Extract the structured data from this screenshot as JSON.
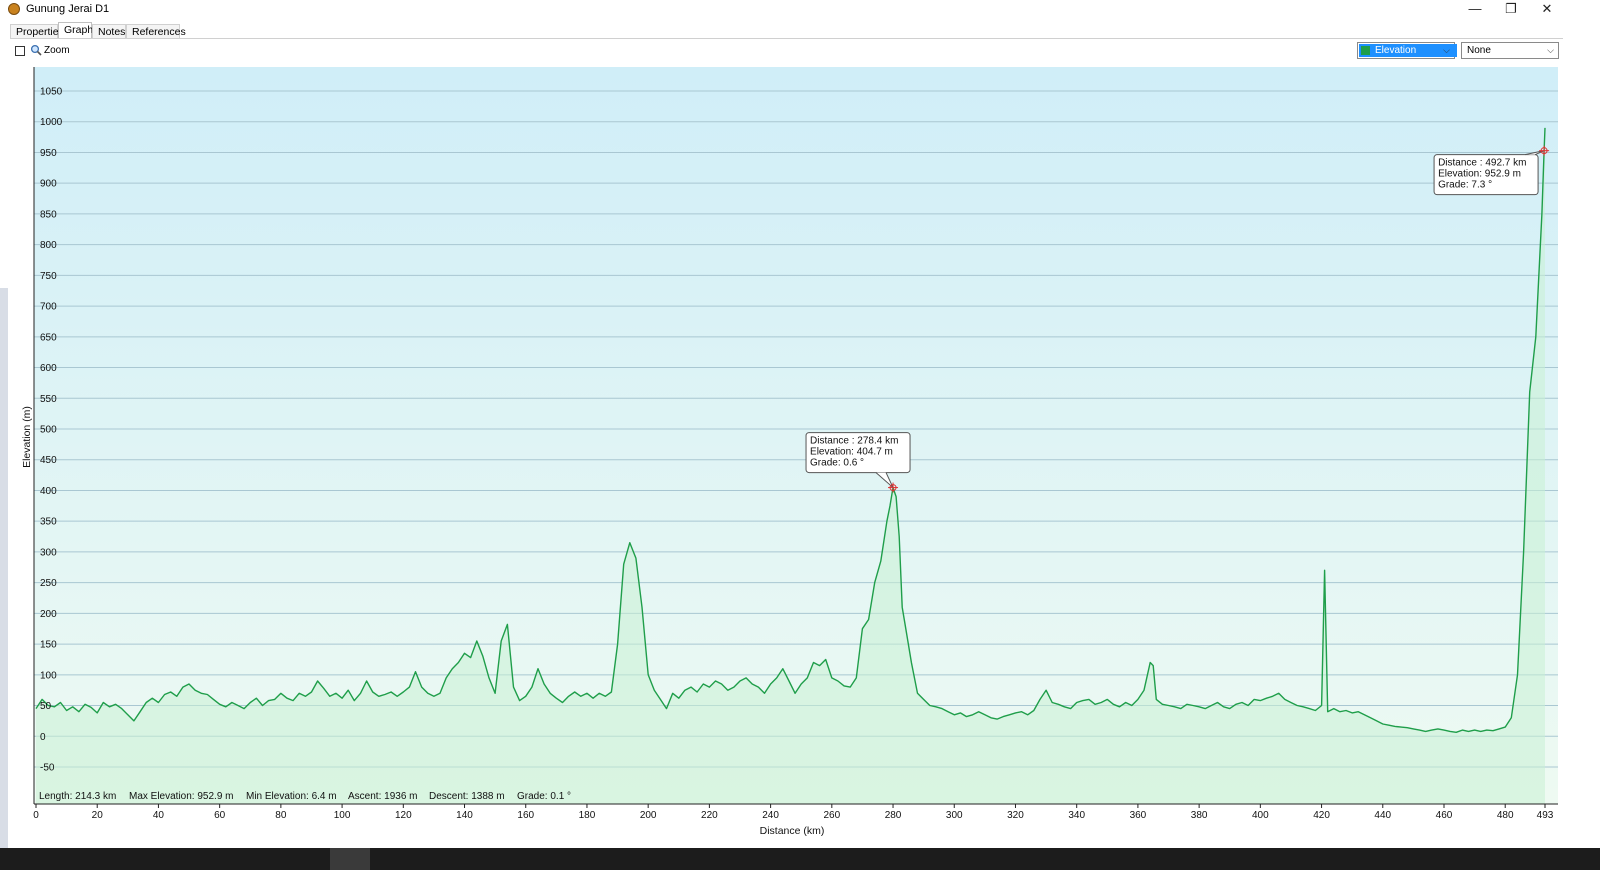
{
  "window": {
    "title": "Gunung Jerai D1",
    "minimize": "—",
    "restore": "❐",
    "close": "✕"
  },
  "tabs": [
    {
      "label": "Properties",
      "active": false
    },
    {
      "label": "Graph",
      "active": true
    },
    {
      "label": "Notes",
      "active": false
    },
    {
      "label": "References",
      "active": false
    }
  ],
  "toolbar": {
    "zoom_label": "Zoom",
    "zoom_checked": false,
    "series_select": "Elevation",
    "secondary_select": "None"
  },
  "colors": {
    "line": "#1f9e4a",
    "fill_top": "#d0eef8",
    "fill_bottom": "#eefaf2",
    "select_highlight": "#1e90ff"
  },
  "chart_data": {
    "type": "area",
    "xlabel": "Distance  (km)",
    "ylabel": "Elevation (m)",
    "xlim": [
      0,
      493
    ],
    "ylim": [
      -60,
      1090
    ],
    "x_ticks": [
      "0",
      "20",
      "40",
      "60",
      "80",
      "100",
      "120",
      "140",
      "160",
      "180",
      "200",
      "220",
      "240",
      "260",
      "280",
      "300",
      "320",
      "340",
      "360",
      "380",
      "400",
      "420",
      "440",
      "460",
      "480",
      "493"
    ],
    "y_ticks": [
      "1050",
      "1000",
      "950",
      "900",
      "850",
      "800",
      "750",
      "700",
      "650",
      "600",
      "550",
      "500",
      "450",
      "400",
      "350",
      "300",
      "250",
      "200",
      "150",
      "100",
      "50",
      "0",
      "-50"
    ],
    "grid": true,
    "series": [
      {
        "name": "Elevation",
        "points": [
          [
            0,
            45
          ],
          [
            2,
            60
          ],
          [
            4,
            50
          ],
          [
            6,
            48
          ],
          [
            8,
            55
          ],
          [
            10,
            42
          ],
          [
            12,
            48
          ],
          [
            14,
            40
          ],
          [
            16,
            52
          ],
          [
            18,
            47
          ],
          [
            20,
            38
          ],
          [
            22,
            55
          ],
          [
            24,
            48
          ],
          [
            26,
            52
          ],
          [
            28,
            45
          ],
          [
            30,
            35
          ],
          [
            32,
            25
          ],
          [
            34,
            40
          ],
          [
            36,
            55
          ],
          [
            38,
            62
          ],
          [
            40,
            55
          ],
          [
            42,
            68
          ],
          [
            44,
            72
          ],
          [
            46,
            65
          ],
          [
            48,
            80
          ],
          [
            50,
            85
          ],
          [
            52,
            75
          ],
          [
            54,
            70
          ],
          [
            56,
            68
          ],
          [
            58,
            60
          ],
          [
            60,
            52
          ],
          [
            62,
            48
          ],
          [
            64,
            55
          ],
          [
            66,
            50
          ],
          [
            68,
            45
          ],
          [
            70,
            55
          ],
          [
            72,
            62
          ],
          [
            74,
            50
          ],
          [
            76,
            58
          ],
          [
            78,
            60
          ],
          [
            80,
            70
          ],
          [
            82,
            62
          ],
          [
            84,
            58
          ],
          [
            86,
            70
          ],
          [
            88,
            65
          ],
          [
            90,
            72
          ],
          [
            92,
            90
          ],
          [
            94,
            78
          ],
          [
            96,
            65
          ],
          [
            98,
            70
          ],
          [
            100,
            62
          ],
          [
            102,
            75
          ],
          [
            104,
            58
          ],
          [
            106,
            70
          ],
          [
            108,
            90
          ],
          [
            110,
            72
          ],
          [
            112,
            65
          ],
          [
            114,
            68
          ],
          [
            116,
            72
          ],
          [
            118,
            65
          ],
          [
            120,
            72
          ],
          [
            122,
            80
          ],
          [
            124,
            105
          ],
          [
            126,
            80
          ],
          [
            128,
            70
          ],
          [
            130,
            65
          ],
          [
            132,
            70
          ],
          [
            134,
            95
          ],
          [
            136,
            110
          ],
          [
            138,
            120
          ],
          [
            140,
            135
          ],
          [
            142,
            128
          ],
          [
            144,
            155
          ],
          [
            146,
            130
          ],
          [
            148,
            95
          ],
          [
            150,
            70
          ],
          [
            152,
            155
          ],
          [
            154,
            182
          ],
          [
            156,
            80
          ],
          [
            158,
            58
          ],
          [
            160,
            65
          ],
          [
            162,
            80
          ],
          [
            164,
            110
          ],
          [
            166,
            85
          ],
          [
            168,
            70
          ],
          [
            170,
            62
          ],
          [
            172,
            55
          ],
          [
            174,
            65
          ],
          [
            176,
            72
          ],
          [
            178,
            65
          ],
          [
            180,
            70
          ],
          [
            182,
            62
          ],
          [
            184,
            70
          ],
          [
            186,
            65
          ],
          [
            188,
            72
          ],
          [
            190,
            150
          ],
          [
            192,
            280
          ],
          [
            194,
            315
          ],
          [
            196,
            290
          ],
          [
            198,
            210
          ],
          [
            200,
            100
          ],
          [
            202,
            75
          ],
          [
            204,
            60
          ],
          [
            206,
            45
          ],
          [
            208,
            70
          ],
          [
            210,
            62
          ],
          [
            212,
            75
          ],
          [
            214,
            80
          ],
          [
            216,
            72
          ],
          [
            218,
            85
          ],
          [
            220,
            80
          ],
          [
            222,
            90
          ],
          [
            224,
            85
          ],
          [
            226,
            75
          ],
          [
            228,
            80
          ],
          [
            230,
            90
          ],
          [
            232,
            95
          ],
          [
            234,
            85
          ],
          [
            236,
            80
          ],
          [
            238,
            70
          ],
          [
            240,
            85
          ],
          [
            242,
            95
          ],
          [
            244,
            110
          ],
          [
            246,
            90
          ],
          [
            248,
            70
          ],
          [
            250,
            85
          ],
          [
            252,
            95
          ],
          [
            254,
            120
          ],
          [
            256,
            115
          ],
          [
            258,
            125
          ],
          [
            260,
            95
          ],
          [
            262,
            90
          ],
          [
            264,
            82
          ],
          [
            266,
            80
          ],
          [
            268,
            95
          ],
          [
            270,
            175
          ],
          [
            272,
            190
          ],
          [
            274,
            250
          ],
          [
            276,
            285
          ],
          [
            278,
            350
          ],
          [
            279,
            375
          ],
          [
            280,
            404.7
          ],
          [
            281,
            390
          ],
          [
            282,
            325
          ],
          [
            283,
            210
          ],
          [
            284,
            180
          ],
          [
            286,
            120
          ],
          [
            288,
            70
          ],
          [
            290,
            60
          ],
          [
            292,
            50
          ],
          [
            294,
            48
          ],
          [
            296,
            45
          ],
          [
            298,
            40
          ],
          [
            300,
            35
          ],
          [
            302,
            38
          ],
          [
            304,
            32
          ],
          [
            306,
            35
          ],
          [
            308,
            40
          ],
          [
            310,
            35
          ],
          [
            312,
            30
          ],
          [
            314,
            28
          ],
          [
            316,
            32
          ],
          [
            318,
            35
          ],
          [
            320,
            38
          ],
          [
            322,
            40
          ],
          [
            324,
            35
          ],
          [
            326,
            42
          ],
          [
            328,
            60
          ],
          [
            330,
            75
          ],
          [
            332,
            55
          ],
          [
            334,
            52
          ],
          [
            336,
            48
          ],
          [
            338,
            45
          ],
          [
            340,
            55
          ],
          [
            342,
            58
          ],
          [
            344,
            60
          ],
          [
            346,
            52
          ],
          [
            348,
            55
          ],
          [
            350,
            60
          ],
          [
            352,
            52
          ],
          [
            354,
            48
          ],
          [
            356,
            55
          ],
          [
            358,
            50
          ],
          [
            360,
            60
          ],
          [
            362,
            75
          ],
          [
            364,
            120
          ],
          [
            365,
            115
          ],
          [
            366,
            60
          ],
          [
            368,
            52
          ],
          [
            370,
            50
          ],
          [
            372,
            48
          ],
          [
            374,
            45
          ],
          [
            376,
            52
          ],
          [
            378,
            50
          ],
          [
            380,
            48
          ],
          [
            382,
            45
          ],
          [
            384,
            50
          ],
          [
            386,
            55
          ],
          [
            388,
            48
          ],
          [
            390,
            45
          ],
          [
            392,
            52
          ],
          [
            394,
            55
          ],
          [
            396,
            50
          ],
          [
            398,
            60
          ],
          [
            400,
            58
          ],
          [
            402,
            62
          ],
          [
            404,
            65
          ],
          [
            406,
            70
          ],
          [
            408,
            60
          ],
          [
            410,
            55
          ],
          [
            412,
            50
          ],
          [
            414,
            48
          ],
          [
            416,
            45
          ],
          [
            418,
            42
          ],
          [
            420,
            50
          ],
          [
            421,
            270
          ],
          [
            422,
            40
          ],
          [
            424,
            45
          ],
          [
            426,
            40
          ],
          [
            428,
            42
          ],
          [
            430,
            38
          ],
          [
            432,
            40
          ],
          [
            434,
            35
          ],
          [
            436,
            30
          ],
          [
            438,
            25
          ],
          [
            440,
            20
          ],
          [
            442,
            18
          ],
          [
            444,
            16
          ],
          [
            446,
            15
          ],
          [
            448,
            14
          ],
          [
            450,
            12
          ],
          [
            452,
            10
          ],
          [
            454,
            8
          ],
          [
            456,
            10
          ],
          [
            458,
            12
          ],
          [
            460,
            10
          ],
          [
            462,
            8
          ],
          [
            464,
            6.4
          ],
          [
            466,
            10
          ],
          [
            468,
            8
          ],
          [
            470,
            10
          ],
          [
            472,
            8
          ],
          [
            474,
            10
          ],
          [
            476,
            9
          ],
          [
            478,
            12
          ],
          [
            480,
            15
          ],
          [
            482,
            30
          ],
          [
            484,
            100
          ],
          [
            486,
            300
          ],
          [
            488,
            560
          ],
          [
            490,
            650
          ],
          [
            492,
            850
          ],
          [
            492.7,
            952.9
          ],
          [
            493,
            990
          ]
        ]
      }
    ],
    "tooltips": [
      {
        "distance": "Distance  : 278.4 km",
        "elevation": "Elevation: 404.7 m",
        "grade": "Grade: 0.6 °",
        "x": 280,
        "y": 404.7
      },
      {
        "distance": "Distance  : 492.7 km",
        "elevation": "Elevation: 952.9 m",
        "grade": "Grade: 7.3 °",
        "x": 492.7,
        "y": 952.9
      }
    ],
    "stats": [
      "Length: 214.3 km",
      "Max Elevation: 952.9 m",
      "Min Elevation: 6.4 m",
      "Ascent: 1936 m",
      "Descent: 1388 m",
      "Grade: 0.1 °"
    ]
  }
}
